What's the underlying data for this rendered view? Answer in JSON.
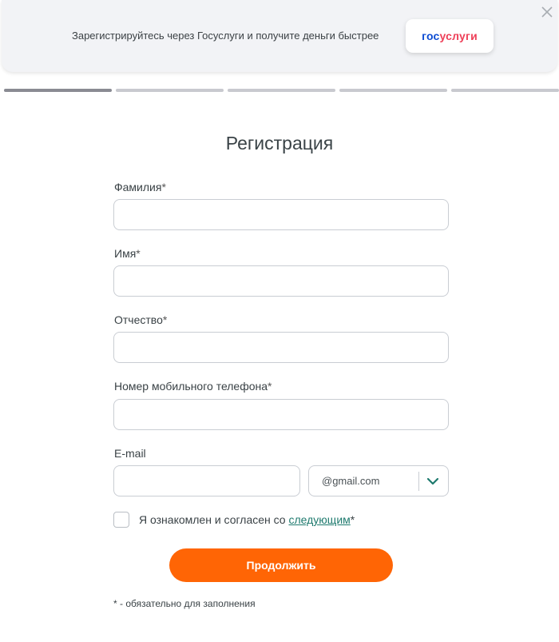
{
  "banner": {
    "text": "Зарегистрируйтесь через Госуслуги и получите деньги быстрее",
    "gosuslugi_part1": "гос",
    "gosuslugi_part2": "услуги",
    "close_icon": "close-icon"
  },
  "progress": {
    "total_steps": 5,
    "current_step": 1
  },
  "form": {
    "title": "Регистрация",
    "required_mark": "*",
    "fields": {
      "last_name": {
        "label": "Фамилия",
        "value": ""
      },
      "first_name": {
        "label": "Имя",
        "value": ""
      },
      "patronymic": {
        "label": "Отчество",
        "value": ""
      },
      "phone": {
        "label": "Номер мобильного телефона",
        "value": ""
      },
      "email": {
        "label": "E-mail",
        "value": "",
        "domain": "@gmail.com"
      }
    },
    "consent": {
      "text": "Я ознакомлен и согласен со ",
      "link": "следующим",
      "mark": "*"
    },
    "submit_label": "Продолжить",
    "footnote": "* - обязательно для заполнения"
  },
  "colors": {
    "accent": "#ff6505",
    "link": "#1e7a6e",
    "progress_active": "#8a8b93",
    "progress_inactive": "#c8c9cf"
  }
}
